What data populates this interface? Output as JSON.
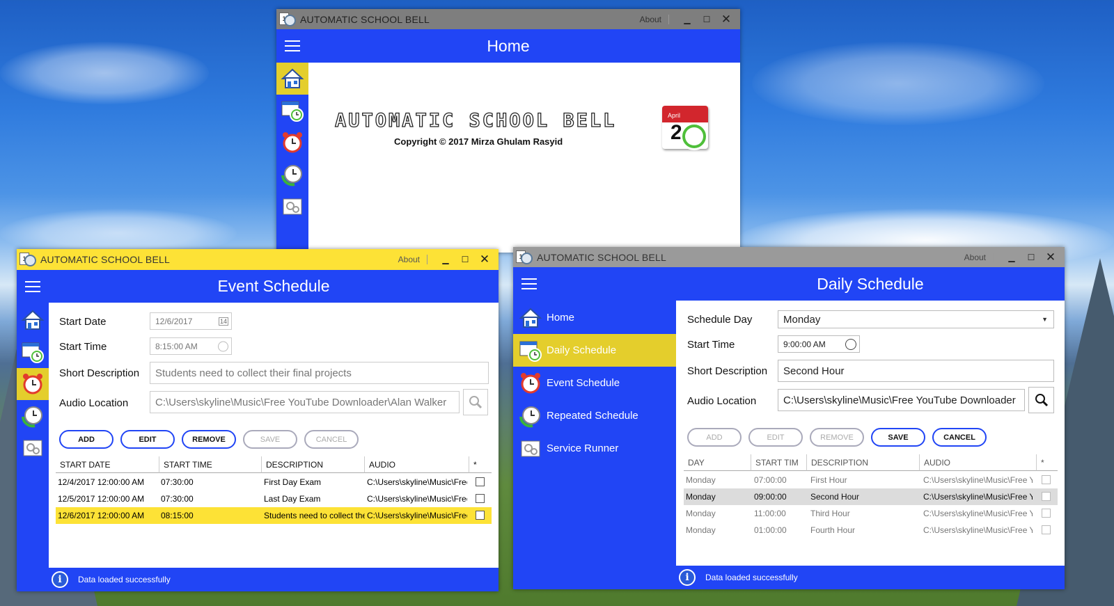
{
  "app_title": "AUTOMATIC SCHOOL BELL",
  "titlebar": {
    "about": "About",
    "minimize": "▁",
    "maximize": "☐",
    "close": "✕"
  },
  "icon_calendar_digit": "1",
  "home": {
    "header_title": "Home",
    "logo_text": "AUTOMATIC SCHOOL BELL",
    "copyright": "Copyright © 2017 Mirza Ghulam Rasyid",
    "calendar_month": "April",
    "calendar_day": "2"
  },
  "nav_icons": [
    "home-icon",
    "daily-schedule-icon",
    "event-schedule-icon",
    "repeated-schedule-icon",
    "service-runner-icon"
  ],
  "event": {
    "header_title": "Event Schedule",
    "labels": {
      "start_date": "Start Date",
      "start_time": "Start Time",
      "short_description": "Short Description",
      "audio_location": "Audio Location"
    },
    "start_date": "12/6/2017",
    "start_time": "8:15:00 AM",
    "date_icon_digit": "14",
    "short_description": "Students need to collect their final projects",
    "audio_location": "C:\\Users\\skyline\\Music\\Free YouTube Downloader\\Alan Walker",
    "buttons": {
      "add": "ADD",
      "edit": "EDIT",
      "remove": "REMOVE",
      "save": "SAVE",
      "cancel": "CANCEL"
    },
    "columns": [
      "START DATE",
      "START TIME",
      "DESCRIPTION",
      "AUDIO",
      "*"
    ],
    "rows": [
      [
        "12/4/2017 12:00:00 AM",
        "07:30:00",
        "First Day Exam",
        "C:\\Users\\skyline\\Music\\Free"
      ],
      [
        "12/5/2017 12:00:00 AM",
        "07:30:00",
        "Last Day Exam",
        "C:\\Users\\skyline\\Music\\Free"
      ],
      [
        "12/6/2017 12:00:00 AM",
        "08:15:00",
        "Students need to collect the",
        "C:\\Users\\skyline\\Music\\Free"
      ]
    ],
    "selected_row": 2,
    "status": "Data loaded successfully"
  },
  "daily": {
    "header_title": "Daily Schedule",
    "menu": [
      "Home",
      "Daily Schedule",
      "Event Schedule",
      "Repeated Schedule",
      "Service Runner"
    ],
    "active_menu": 1,
    "labels": {
      "schedule_day": "Schedule Day",
      "start_time": "Start Time",
      "short_description": "Short Description",
      "audio_location": "Audio Location"
    },
    "schedule_day": "Monday",
    "start_time": "9:00:00 AM",
    "short_description": "Second Hour",
    "audio_location": "C:\\Users\\skyline\\Music\\Free YouTube Downloader",
    "buttons": {
      "add": "ADD",
      "edit": "EDIT",
      "remove": "REMOVE",
      "save": "SAVE",
      "cancel": "CANCEL"
    },
    "columns": [
      "DAY",
      "START TIM",
      "DESCRIPTION",
      "AUDIO",
      "*"
    ],
    "rows": [
      [
        "Monday",
        "07:00:00",
        "First Hour",
        "C:\\Users\\skyline\\Music\\Free Yo"
      ],
      [
        "Monday",
        "09:00:00",
        "Second Hour",
        "C:\\Users\\skyline\\Music\\Free Yo"
      ],
      [
        "Monday",
        "11:00:00",
        "Third Hour",
        "C:\\Users\\skyline\\Music\\Free Yo"
      ],
      [
        "Monday",
        "01:00:00",
        "Fourth Hour",
        "C:\\Users\\skyline\\Music\\Free Yo"
      ]
    ],
    "selected_row": 1,
    "status": "Data loaded successfully"
  },
  "colors": {
    "accent_blue": "#2145f5",
    "highlight_yellow": "#e4ce2c",
    "titlebar_gray": "#7e7e7e",
    "active_titlebar": "#fde236"
  }
}
